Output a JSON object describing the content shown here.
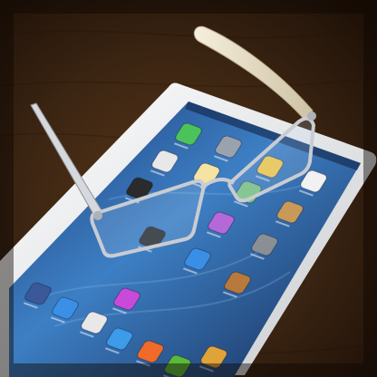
{
  "scene": {
    "colors": {
      "table": "#3a2412",
      "table_dark": "#1c0f06",
      "device_body": "#eef0f2",
      "screen_top": "#1e3f7a",
      "screen_mid": "#3d7fc4",
      "screen_bottom": "#172d58",
      "glasses_frame": "#c9ccd2",
      "temple_arm": "#e6ddc6"
    }
  },
  "device": {
    "app_icons": [
      {
        "icon": "green-app-icon",
        "color": "#4cc35a"
      },
      {
        "icon": "gray-app-icon",
        "color": "#9aa3ad"
      },
      {
        "icon": "calendar-icon",
        "color": "#e8e8e8"
      },
      {
        "icon": "photos-icon",
        "color": "#f2c74a"
      },
      {
        "icon": "clock-icon",
        "color": "#2b2b2b"
      },
      {
        "icon": "notes-icon",
        "color": "#f4e3a1"
      },
      {
        "icon": "reminders-icon",
        "color": "#f1f1f1"
      },
      {
        "icon": "maps-icon",
        "color": "#7cc27e"
      },
      {
        "icon": "videos-icon",
        "color": "#2d2d2d"
      },
      {
        "icon": "game-center-icon",
        "color": "#b568d8"
      },
      {
        "icon": "contacts-icon",
        "color": "#c79a5a"
      },
      {
        "icon": "itunes-icon",
        "color": "#c84ad9"
      },
      {
        "icon": "app-store-icon",
        "color": "#3a8ee6"
      },
      {
        "icon": "settings-icon",
        "color": "#8a8f96"
      },
      {
        "icon": "newsstand-icon",
        "color": "#b87a3c"
      },
      {
        "icon": "facebook-icon",
        "color": "#3b5998"
      },
      {
        "icon": "mail-icon",
        "color": "#3b8fe6"
      },
      {
        "icon": "chrome-icon",
        "color": "#e8e8e8"
      },
      {
        "icon": "safari-icon",
        "color": "#3d9be9"
      },
      {
        "icon": "music-icon",
        "color": "#f06a2a"
      },
      {
        "icon": "evernote-icon",
        "color": "#5bb83a"
      },
      {
        "icon": "stickies-icon",
        "color": "#e0a33a"
      }
    ]
  }
}
